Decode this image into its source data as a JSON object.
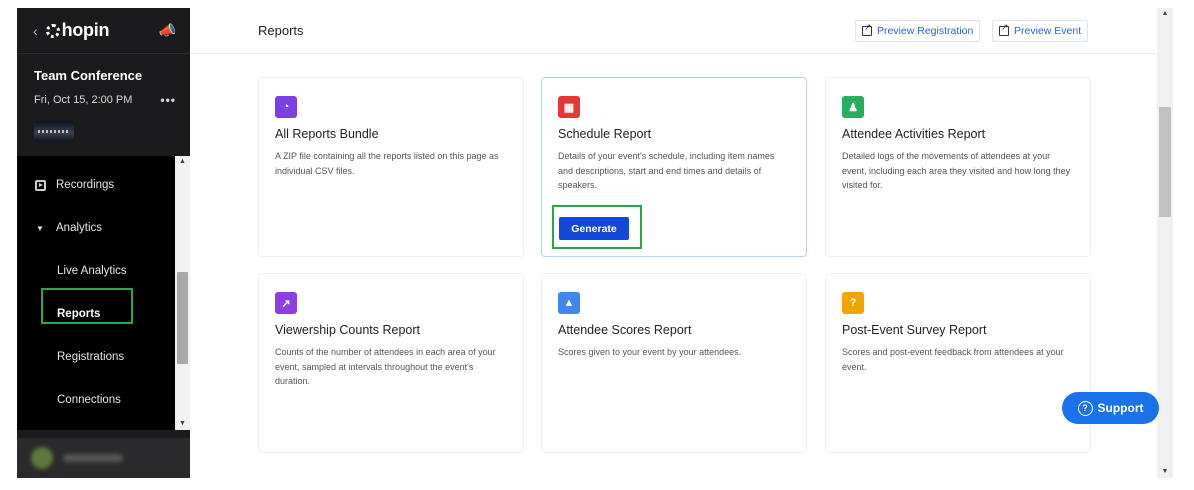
{
  "sidebar": {
    "logo": "hopin",
    "event_title": "Team Conference",
    "event_date": "Fri, Oct 15, 2:00 PM",
    "menu_dots": "•••",
    "items": {
      "recordings": "Recordings",
      "analytics": "Analytics",
      "live_analytics": "Live Analytics",
      "reports": "Reports",
      "registrations": "Registrations",
      "connections": "Connections"
    }
  },
  "header": {
    "title": "Reports",
    "preview_registration": "Preview Registration",
    "preview_event": "Preview Event"
  },
  "cards": [
    {
      "title": "All Reports Bundle",
      "desc": "A ZIP file containing all the reports listed on this page as individual CSV files.",
      "icon": "pie-chart-icon",
      "color": "#7b3fe4"
    },
    {
      "title": "Schedule Report",
      "desc": "Details of your event's schedule, including item names and descriptions, start and end times and details of speakers.",
      "icon": "calendar-icon",
      "color": "#e53935",
      "action": "Generate"
    },
    {
      "title": "Attendee Activities Report",
      "desc": "Detailed logs of the movements of attendees at your event, including each area they visited and how long they visited for.",
      "icon": "user-activity-icon",
      "color": "#27ae60"
    },
    {
      "title": "Viewership Counts Report",
      "desc": "Counts of the number of attendees in each area of your event, sampled at intervals throughout the event's duration.",
      "icon": "trend-icon",
      "color": "#8e3fe4"
    },
    {
      "title": "Attendee Scores Report",
      "desc": "Scores given to your event by your attendees.",
      "icon": "thumbs-up-icon",
      "color": "#3f86f0"
    },
    {
      "title": "Post-Event Survey Report",
      "desc": "Scores and post-event feedback from attendees at your event.",
      "icon": "question-icon",
      "color": "#f0a500"
    }
  ],
  "support": "Support",
  "accent_selected": "#2ea44f",
  "primary_button": "#1248d6"
}
